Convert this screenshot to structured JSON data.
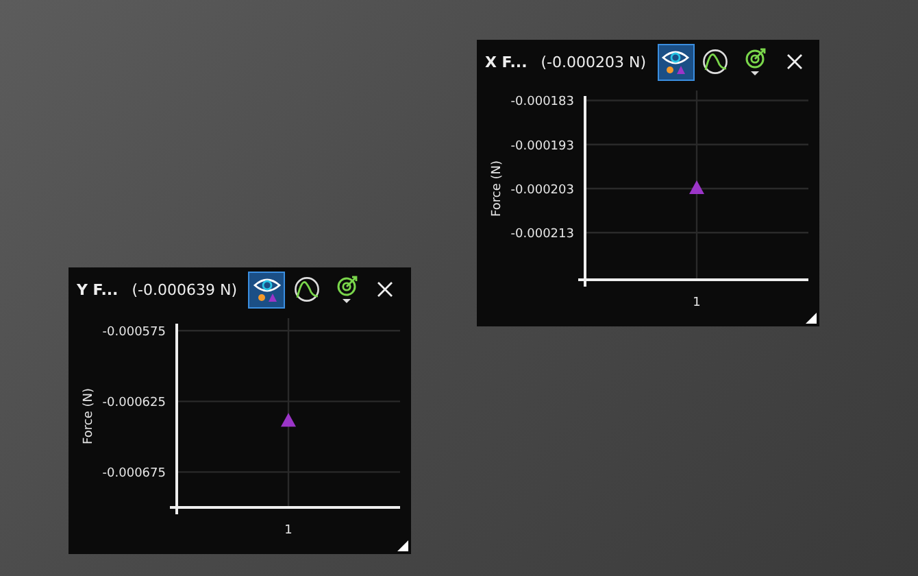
{
  "panels": [
    {
      "title": "X F...",
      "reading": "(-0.000203 N)",
      "tools": [
        {
          "kind": "eye",
          "selected": true
        },
        {
          "kind": "curve",
          "selected": false
        },
        {
          "kind": "target",
          "selected": false
        }
      ],
      "chart_data": {
        "type": "scatter",
        "grid": true,
        "ylabel": "Force (N)",
        "categories": [
          "1"
        ],
        "ylim": [
          -0.000224,
          -0.000182
        ],
        "yticks": [
          {
            "value": -0.000183,
            "label": "-0.000183"
          },
          {
            "value": -0.000193,
            "label": "-0.000193"
          },
          {
            "value": -0.000203,
            "label": "-0.000203"
          },
          {
            "value": -0.000213,
            "label": "-0.000213"
          }
        ],
        "series": [
          {
            "color": "#9b35c8",
            "values": [
              -0.000203
            ]
          }
        ]
      }
    },
    {
      "title": "Y F...",
      "reading": "(-0.000639 N)",
      "tools": [
        {
          "kind": "eye",
          "selected": true
        },
        {
          "kind": "curve",
          "selected": false
        },
        {
          "kind": "target",
          "selected": false
        }
      ],
      "chart_data": {
        "type": "scatter",
        "grid": true,
        "ylabel": "Force (N)",
        "categories": [
          "1"
        ],
        "ylim": [
          -0.000701,
          -0.00057
        ],
        "yticks": [
          {
            "value": -0.000575,
            "label": "-0.000575"
          },
          {
            "value": -0.000625,
            "label": "-0.000625"
          },
          {
            "value": -0.000675,
            "label": "-0.000675"
          }
        ],
        "series": [
          {
            "color": "#9b35c8",
            "values": [
              -0.000639
            ]
          }
        ]
      }
    }
  ]
}
